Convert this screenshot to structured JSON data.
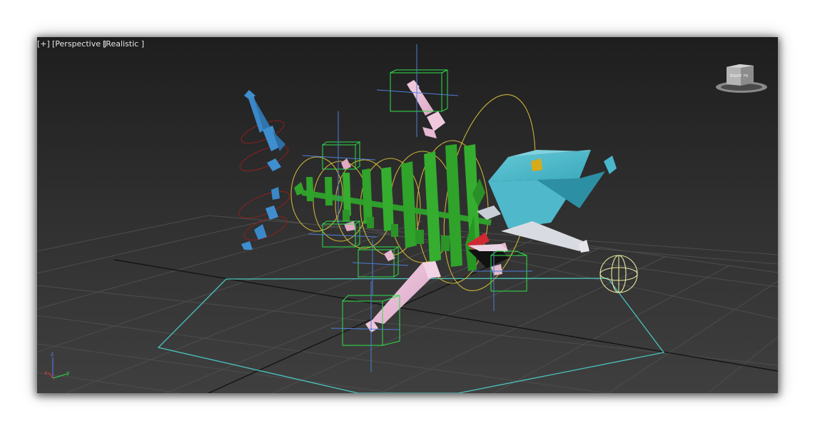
{
  "viewport": {
    "labels": {
      "menu": "[+]",
      "view": "[Perspective ]",
      "shading": "[Realistic ]"
    },
    "axis_tripod": {
      "z": "z",
      "x": "x",
      "y": "y"
    },
    "viewcube": {
      "face": "RIGHT",
      "side": "FR"
    }
  }
}
